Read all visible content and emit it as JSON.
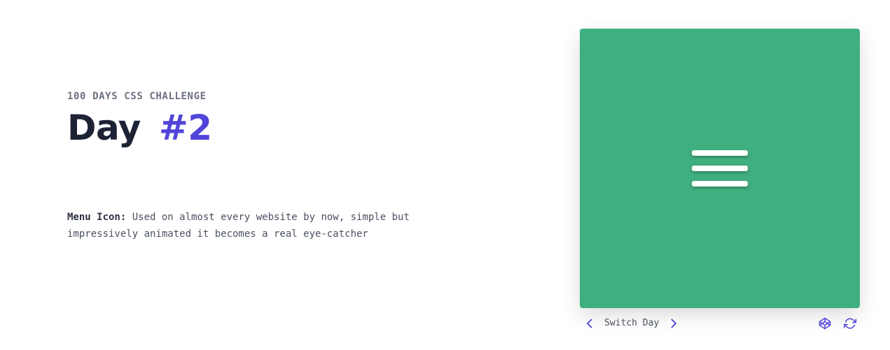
{
  "header": {
    "kicker": "100 DAYS CSS CHALLENGE",
    "title_word": "Day",
    "title_number": "#2"
  },
  "description": {
    "label": "Menu Icon:",
    "text": " Used on almost every website by now, simple but impressively animated it becomes a real eye-catcher"
  },
  "controls": {
    "switch_label": "Switch Day",
    "prev_icon": "chevron-left-icon",
    "next_icon": "chevron-right-icon",
    "codepen_icon": "codepen-icon",
    "refresh_icon": "refresh-icon"
  },
  "colors": {
    "stage_background": "#40af7f",
    "accent": "#5145d9",
    "heading": "#1e2235",
    "menu_bars": "#ffffff"
  }
}
